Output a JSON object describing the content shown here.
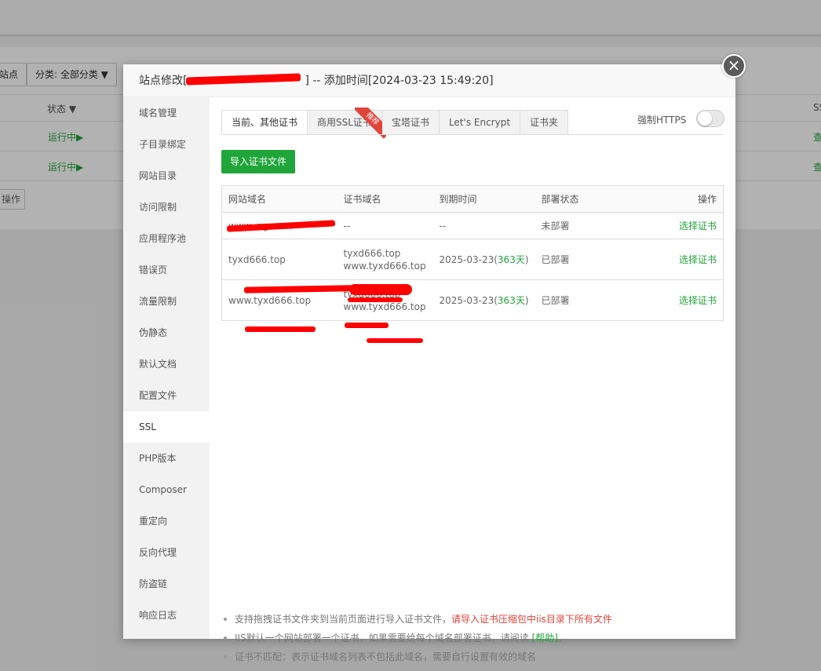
{
  "background": {
    "buttons": [
      "站点",
      "分类: 全部分类 ▼"
    ],
    "status_header": "状态 ▼",
    "ssl_header": "SS",
    "running_label": "运行中▶",
    "action_label": "查",
    "op_button": "操作"
  },
  "modal": {
    "title_prefix": "站点修改[",
    "title_suffix": "] -- 添加时间[2024-03-23 15:49:20]",
    "close_icon": "×",
    "sidebar": [
      "域名管理",
      "子目录绑定",
      "网站目录",
      "访问限制",
      "应用程序池",
      "错误页",
      "流量限制",
      "伪静态",
      "默认文档",
      "配置文件",
      "SSL",
      "PHP版本",
      "Composer",
      "重定向",
      "反向代理",
      "防盗链",
      "响应日志"
    ],
    "active_sidebar": "SSL",
    "tabs": [
      "当前、其他证书",
      "商用SSL证书",
      "宝塔证书",
      "Let's Encrypt",
      "证书夹"
    ],
    "ribbon_label": "推荐",
    "force_https_label": "强制HTTPS",
    "import_button": "导入证书文件",
    "table": {
      "headers": [
        "网站域名",
        "证书域名",
        "到期时间",
        "部署状态",
        "操作"
      ],
      "rows": [
        {
          "site": "www.         ng.com",
          "cert_line1": "--",
          "cert_line2": "",
          "expire": "--",
          "days": "",
          "status": "未部署",
          "action": "选择证书"
        },
        {
          "site": "tyxd666.top",
          "cert_line1": "tyxd666.top",
          "cert_line2": "www.tyxd666.top",
          "expire": "2025-03-23(",
          "days": "363天",
          "status": "已部署",
          "action": "选择证书"
        },
        {
          "site": "www.tyxd666.top",
          "cert_line1": "tyxd666.top",
          "cert_line2": "www.tyxd666.top",
          "expire": "2025-03-23(",
          "days": "363天",
          "status": "已部署",
          "action": "选择证书"
        }
      ]
    },
    "notes": {
      "n1_text": "支持拖拽证书文件夹到当前页面进行导入证书文件，",
      "n1_red": "请导入证书压缩包中iis目录下所有文件",
      "n2_text": "IIS默认一个网站部署一个证书，如果需要给每个域名部署证书，请阅读 ",
      "n2_link": "[帮助]",
      "n2_end": "。",
      "n3_text": "证书不匹配：表示证书域名列表不包括此域名，需要自行设置有效的域名"
    }
  },
  "colors": {
    "accent": "#20a53a",
    "danger": "#e0453c"
  }
}
